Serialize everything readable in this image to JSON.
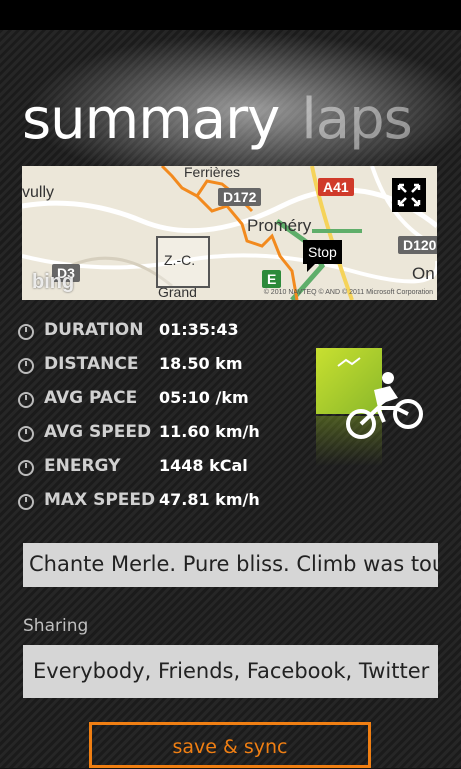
{
  "pivot": {
    "active": "summary",
    "inactive": "laps"
  },
  "map": {
    "labels": {
      "ferrieres": "Ferrières",
      "vully": "vully",
      "promery": "Proméry",
      "grand": "Grand",
      "on": "On",
      "zc": "Z.-C."
    },
    "roads": {
      "d172": "D172",
      "a41": "A41",
      "d120": "D120",
      "d3": "D3",
      "e": "E"
    },
    "stop_label": "Stop",
    "logo": "bing",
    "copyright": "© 2010 NAVTEQ © AND © 2011 Microsoft Corporation"
  },
  "stats": [
    {
      "icon": "clock-icon",
      "label": "DURATION",
      "value": "01:35:43"
    },
    {
      "icon": "distance-icon",
      "label": "DISTANCE",
      "value": "18.50 km"
    },
    {
      "icon": "pace-icon",
      "label": "AVG PACE",
      "value": "05:10 /km"
    },
    {
      "icon": "speed-icon",
      "label": "AVG SPEED",
      "value": "11.60 km/h"
    },
    {
      "icon": "energy-icon",
      "label": "ENERGY",
      "value": "1448 kCal"
    },
    {
      "icon": "max-speed-icon",
      "label": "MAX SPEED",
      "value": "47.81  km/h"
    }
  ],
  "activity": {
    "icon": "cycling-icon",
    "color": "#b4d22e"
  },
  "note": {
    "value": "Chante Merle. Pure bliss. Climb was tough"
  },
  "sharing": {
    "label": "Sharing",
    "value": "Everybody, Friends, Facebook, Twitter"
  },
  "actions": {
    "save_sync": "save & sync"
  },
  "colors": {
    "accent": "#f07f13",
    "route": "#f28a1e"
  }
}
